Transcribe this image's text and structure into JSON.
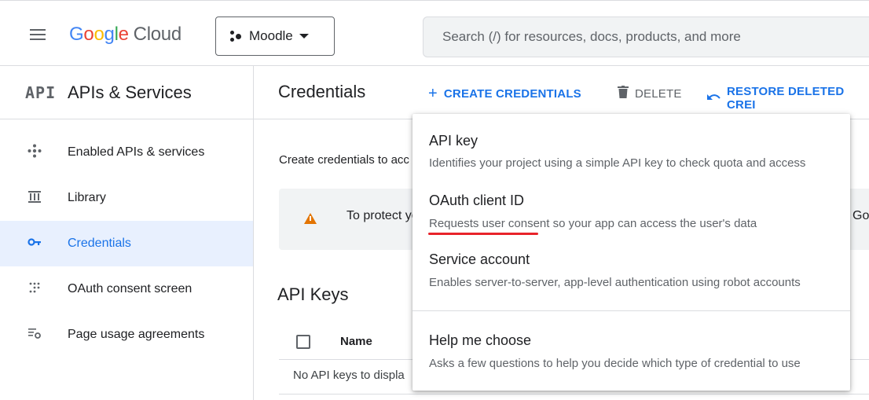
{
  "header": {
    "logo": {
      "letters": [
        "G",
        "o",
        "o",
        "g",
        "l",
        "e"
      ],
      "suffix": "Cloud"
    },
    "project": "Moodle",
    "search_placeholder": "Search (/) for resources, docs, products, and more"
  },
  "sidebar": {
    "mark": "API",
    "title": "APIs & Services",
    "items": [
      {
        "label": "Enabled APIs & services",
        "icon": "hub-icon"
      },
      {
        "label": "Library",
        "icon": "library-icon"
      },
      {
        "label": "Credentials",
        "icon": "key-icon",
        "active": true
      },
      {
        "label": "OAuth consent screen",
        "icon": "dots-icon"
      },
      {
        "label": "Page usage agreements",
        "icon": "settings-list-icon"
      }
    ]
  },
  "main": {
    "title": "Credentials",
    "toolbar": {
      "create": "CREATE CREDENTIALS",
      "delete": "DELETE",
      "restore": "RESTORE DELETED CREI"
    },
    "description": "Create credentials to acc",
    "warning": {
      "text": "To protect yo",
      "trail": "Goc"
    },
    "keys_title": "API Keys",
    "table": {
      "col_name": "Name",
      "empty": "No API keys to displa"
    }
  },
  "menu": {
    "items": [
      {
        "title": "API key",
        "desc": "Identifies your project using a simple API key to check quota and access"
      },
      {
        "title": "OAuth client ID",
        "desc": "Requests user consent so your app can access the user's data"
      },
      {
        "title": "Service account",
        "desc": "Enables server-to-server, app-level authentication using robot accounts"
      },
      {
        "title": "Help me choose",
        "desc": "Asks a few questions to help you decide which type of credential to use"
      }
    ]
  },
  "colors": {
    "accent": "#1a73e8",
    "warning": "#e37400",
    "annotation": "#e8232a"
  }
}
